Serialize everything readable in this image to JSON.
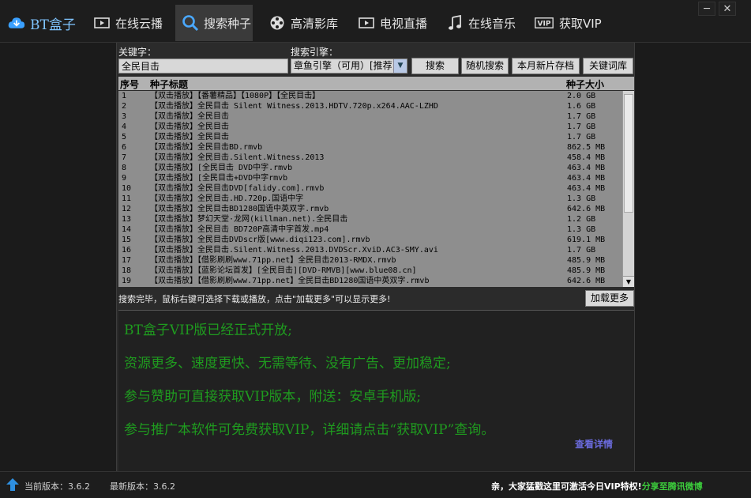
{
  "nav": {
    "logo": "BT盒子",
    "items": [
      {
        "label": "在线云播"
      },
      {
        "label": "搜索种子"
      },
      {
        "label": "高清影库"
      },
      {
        "label": "电视直播"
      },
      {
        "label": "在线音乐"
      },
      {
        "label": "获取VIP"
      }
    ],
    "minimize": "─",
    "close": "✕"
  },
  "search": {
    "keyword_label": "关键字：",
    "keyword_value": "全民目击",
    "engine_label": "搜索引擎：",
    "engine_value": "章鱼引擎（可用）[推荐]",
    "buttons": {
      "search": "搜索",
      "random": "随机搜索",
      "monthly": "本月新片存档",
      "keywords": "关键词库"
    }
  },
  "table": {
    "columns": {
      "no": "序号",
      "title": "种子标题",
      "size": "种子大小"
    },
    "rows": [
      {
        "no": "1",
        "title": "【双击播放】【番薯精品】【1080P】【全民目击】",
        "size": "2.0 GB"
      },
      {
        "no": "2",
        "title": "【双击播放】全民目击 Silent Witness.2013.HDTV.720p.x264.AAC-LZHD",
        "size": "1.6 GB"
      },
      {
        "no": "3",
        "title": "【双击播放】全民目击",
        "size": "1.7 GB"
      },
      {
        "no": "4",
        "title": "【双击播放】全民目击",
        "size": "1.7 GB"
      },
      {
        "no": "5",
        "title": "【双击播放】全民目击",
        "size": "1.7 GB"
      },
      {
        "no": "6",
        "title": "【双击播放】全民目击BD.rmvb",
        "size": "862.5 MB"
      },
      {
        "no": "7",
        "title": "【双击播放】全民目击.Silent.Witness.2013",
        "size": "458.4 MB"
      },
      {
        "no": "8",
        "title": "【双击播放】[全民目击 DVD中字.rmvb",
        "size": "463.4 MB"
      },
      {
        "no": "9",
        "title": "【双击播放】[全民目击+DVD中字rmvb",
        "size": "463.4 MB"
      },
      {
        "no": "10",
        "title": "【双击播放】全民目击DVD[falidy.com].rmvb",
        "size": "463.4 MB"
      },
      {
        "no": "11",
        "title": "【双击播放】全民目击.HD.720p.国语中字",
        "size": "1.3 GB"
      },
      {
        "no": "12",
        "title": "【双击播放】全民目击BD1280国语中英双字.rmvb",
        "size": "642.6 MB"
      },
      {
        "no": "13",
        "title": "【双击播放】梦幻天堂·龙网(killman.net).全民目击",
        "size": "1.2 GB"
      },
      {
        "no": "14",
        "title": "【双击播放】全民目击 BD720P高清中字首发.mp4",
        "size": "1.3 GB"
      },
      {
        "no": "15",
        "title": "【双击播放】全民目击DVDscr版[www.diqi123.com].rmvb",
        "size": "619.1 MB"
      },
      {
        "no": "16",
        "title": "【双击播放】全民目击.Silent.Witness.2013.DVDScr.XviD.AC3-SMY.avi",
        "size": "1.7 GB"
      },
      {
        "no": "17",
        "title": "【双击播放】【借影刷刷www.71pp.net】全民目击2013-RMDX.rmvb",
        "size": "485.9 MB"
      },
      {
        "no": "18",
        "title": "【双击播放】【蓝影论坛首发】[全民目击][DVD-RMVB][www.blue08.cn]",
        "size": "485.9 MB"
      },
      {
        "no": "19",
        "title": "【双击播放】【借影刷刷www.71pp.net】全民目击BD1280国语中英双字.rmvb",
        "size": "642.6 MB"
      }
    ]
  },
  "status": {
    "message": "搜索完毕，鼠标右键可选择下载或播放，点击\"加载更多\"可以显示更多!",
    "more_button": "加载更多"
  },
  "promo": {
    "lines": [
      "BT盒子VIP版已经正式开放;",
      "资源更多、速度更快、无需等待、没有广告、更加稳定;",
      "参与赞助可直接获取VIP版本，附送：安卓手机版;",
      "参与推广本软件可免费获取VIP，详细请点击“获取VIP”查询。"
    ],
    "details_link": "查看详情",
    "text_color": "#1f9b1f"
  },
  "footer": {
    "current_version": "当前版本：3.6.2",
    "latest_version": "最新版本：3.6.2",
    "tip": "亲，大家猛戳这里可激活今日VIP特权!",
    "share": "分享至腾讯微博"
  }
}
